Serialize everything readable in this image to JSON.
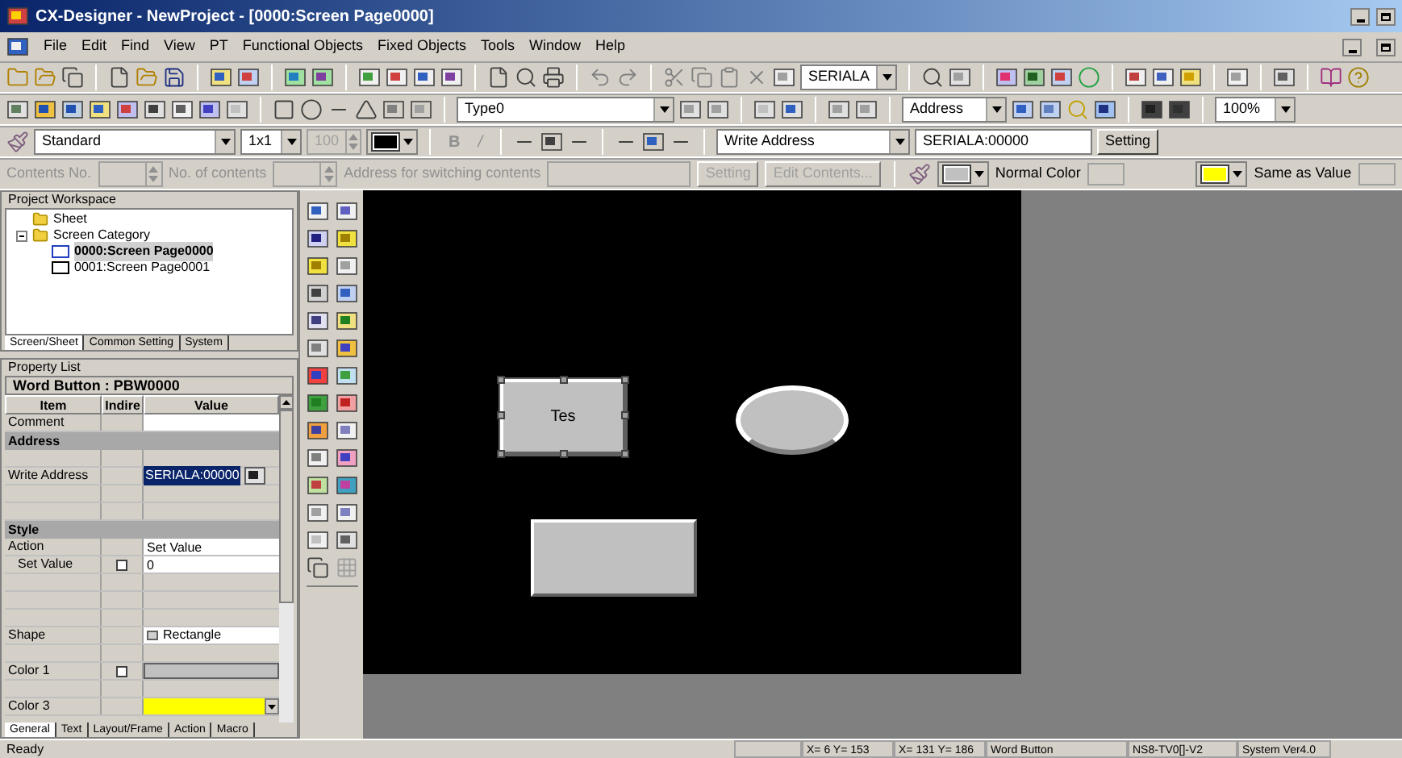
{
  "window": {
    "title": "CX-Designer - NewProject - [0000:Screen Page0000]"
  },
  "menu": [
    "File",
    "Edit",
    "Find",
    "View",
    "PT",
    "Functional Objects",
    "Fixed Objects",
    "Tools",
    "Window",
    "Help"
  ],
  "toolbar_1": {
    "combo": "SERIALA"
  },
  "toolbar_2": {
    "type_combo": "Type0",
    "label_combo": "Address",
    "zoom_combo": "100%"
  },
  "toolbar_3": {
    "font_combo": "Standard",
    "scale_combo": "1x1",
    "size_field": {
      "value": "100",
      "disabled": true
    },
    "bold": "B",
    "italic": "/",
    "address_combo": "Write Address",
    "address_field": "SERIALA:00000",
    "setting_button": "Setting"
  },
  "toolbar_4": {
    "contents_no": {
      "label": "Contents No.",
      "disabled": true
    },
    "no_of_contents": {
      "label": "No. of contents",
      "disabled": true
    },
    "switch_address": {
      "label": "Address for switching contents",
      "disabled": true
    },
    "setting_button": {
      "label": "Setting",
      "disabled": true
    },
    "edit_button": {
      "label": "Edit Contents...",
      "disabled": true
    },
    "normal_color": {
      "label": "Normal Color",
      "color": "#c0c0c0"
    },
    "value_color": {
      "label": "Same as Value",
      "color": "#ffff00"
    }
  },
  "workspace": {
    "title": "Project Workspace",
    "tree": [
      {
        "label": "Sheet",
        "expanded": false
      },
      {
        "label": "Screen Category",
        "expanded": true,
        "children": [
          {
            "label": "0000:Screen Page0000",
            "selected": true
          },
          {
            "label": "0001:Screen Page0001",
            "selected": false
          }
        ]
      }
    ],
    "tabs": [
      {
        "label": "Screen/Sheet",
        "selected": true
      },
      {
        "label": "Common Setting",
        "selected": false
      },
      {
        "label": "System",
        "selected": false
      }
    ]
  },
  "property_list": {
    "title": "Property List",
    "object": "Word Button : PBW0000",
    "columns": [
      "Item",
      "Indire",
      "Value"
    ],
    "rows": [
      {
        "kind": "input",
        "label": "Comment"
      },
      {
        "kind": "section",
        "label": "Address"
      },
      {
        "kind": "blank"
      },
      {
        "kind": "highlight",
        "label": "Write Address",
        "value": "SERIALA:00000"
      },
      {
        "kind": "blank"
      },
      {
        "kind": "blank"
      },
      {
        "kind": "section",
        "label": "Style"
      },
      {
        "kind": "input",
        "label": "Action",
        "value": "Set Value"
      },
      {
        "kind": "input",
        "label": "Set Value",
        "indent": true,
        "checked": false,
        "value": "0"
      },
      {
        "kind": "blank"
      },
      {
        "kind": "blank"
      },
      {
        "kind": "blank"
      },
      {
        "kind": "shape",
        "label": "Shape",
        "value": "Rectangle"
      },
      {
        "kind": "blank"
      },
      {
        "kind": "color",
        "label": "Color 1",
        "checked": false,
        "color": "#c0c0c0"
      },
      {
        "kind": "blank"
      },
      {
        "kind": "color_combo",
        "label": "Color 3",
        "color": "#ffff00"
      }
    ],
    "tabs": [
      {
        "label": "General",
        "selected": true
      },
      {
        "label": "Text",
        "selected": false
      },
      {
        "label": "Layout/Frame",
        "selected": false
      },
      {
        "label": "Action",
        "selected": false
      },
      {
        "label": "Macro",
        "selected": false
      }
    ]
  },
  "canvas": {
    "objects": [
      {
        "kind": "button",
        "label": "Tes",
        "selected": true
      },
      {
        "kind": "lamp",
        "selected": false
      },
      {
        "kind": "button",
        "selected": false
      }
    ]
  },
  "status_bar": {
    "message": "Ready",
    "cells": [
      "",
      "X=  6 Y= 153",
      "X= 131 Y= 186",
      "Word Button",
      "NS8-TV0[]-V2",
      "System Ver4.0"
    ]
  }
}
